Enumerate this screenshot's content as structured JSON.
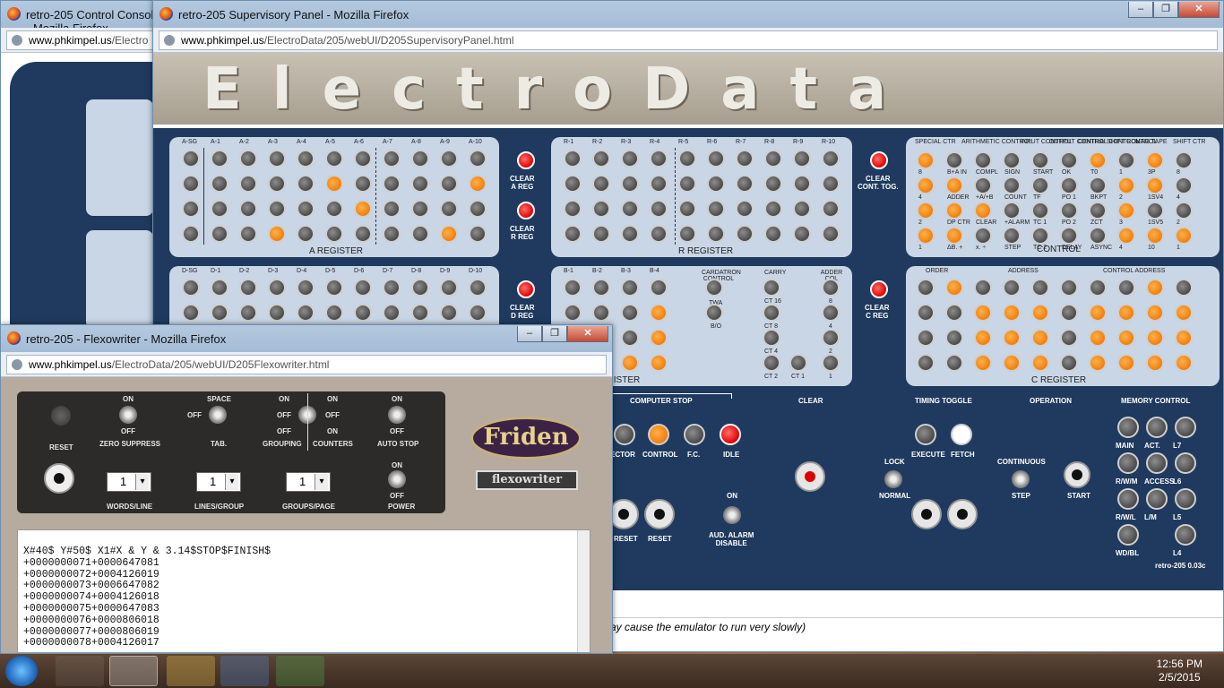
{
  "console_window": {
    "title": "retro-205 Control Console - Mozilla Firefox",
    "url_host": "www.phkimpel.us",
    "url_rest": "/Electro"
  },
  "supervisory": {
    "title": "retro-205 Supervisory Panel - Mozilla Firefox",
    "url_host": "www.phkimpel.us",
    "url_rest": "/ElectroData/205/webUI/D205SupervisoryPanel.html",
    "banner": "ElectroData",
    "a_labels": [
      "A-SG",
      "A-1",
      "A-2",
      "A-3",
      "A-4",
      "A-5",
      "A-6",
      "A-7",
      "A-8",
      "A-9",
      "A-10"
    ],
    "r_labels": [
      "R-1",
      "R-2",
      "R-3",
      "R-4",
      "R-5",
      "R-6",
      "R-7",
      "R-8",
      "R-9",
      "R-10"
    ],
    "d_labels": [
      "D-SG",
      "D-1",
      "D-2",
      "D-3",
      "D-4",
      "D-5",
      "D-6",
      "D-7",
      "D-8",
      "D-9",
      "D-10"
    ],
    "b_labels": [
      "B-1",
      "B-2",
      "B-3",
      "B-4"
    ],
    "a_register": "A REGISTER",
    "r_register": "R REGISTER",
    "c_register": "C REGISTER",
    "control": "CONTROL",
    "b_register_partial": "GISTER",
    "clear_a": "CLEAR\nA REG",
    "clear_r": "CLEAR\nR REG",
    "clear_d": "CLEAR\nD REG",
    "clear_cont": "CLEAR\nCONT. TOG.",
    "clear_c": "CLEAR\nC REG",
    "control_heads": [
      "SPECIAL CTR",
      "ARITHMETIC CONTROL",
      "INPUT CONTROL",
      "OUTPUT CONTROL",
      "CENTRAL CONTROL",
      "SHIFT CONTROL",
      "MAG TAPE",
      "SHIFT CTR"
    ],
    "control_cells": [
      "8",
      "B+A IN",
      "COMPL",
      "SIGN",
      "START",
      "OK",
      "T0",
      "1",
      "3P",
      "8",
      "4",
      "ADDER",
      "+A/+B",
      "COUNT",
      "TF",
      "PO 1",
      "BKPT",
      "2",
      "1SV4",
      "4",
      "2",
      "DP CTR",
      "CLEAR",
      "+ALARM",
      "TC 1",
      "PO 2",
      "ZCT",
      "3",
      "1SV5",
      "2",
      "1",
      "ΔB. +",
      "x. ÷",
      "STEP",
      "TC 2",
      "DELAY",
      "ASYNC",
      "4",
      "10",
      "1"
    ],
    "c_heads": [
      "ORDER",
      "ADDRESS",
      "CONTROL ADDRESS"
    ],
    "cardatron": "CARDATRON CONTROL",
    "twa": "TWA",
    "bo": "B/O",
    "carry": "CARRY",
    "adder_col": "ADDER COL",
    "carry_cells": [
      "CT 16",
      "CT 8",
      "CT 4",
      "CT 2",
      "CT 1"
    ],
    "adder_cells": [
      "8",
      "4",
      "2",
      "1"
    ],
    "computer_stop": "COMPUTER STOP",
    "clear": "CLEAR",
    "timing_toggle": "TIMING TOGGLE",
    "operation": "OPERATION",
    "memory_control": "MEMORY CONTROL",
    "stop_lamps": [
      "ECTOR",
      "CONTROL",
      "F.C.",
      "IDLE"
    ],
    "execute": "EXECUTE",
    "fetch": "FETCH",
    "lock": "LOCK",
    "normal": "NORMAL",
    "continuous": "CONTINUOUS",
    "step": "STEP",
    "start": "START",
    "reset1": "RESET",
    "reset2": "RESET",
    "aud_on": "ON",
    "aud_alarm": "AUD. ALARM\nDISABLE",
    "mem": [
      "MAIN",
      "ACT.",
      "L7",
      "R/W/M",
      "ACCESS",
      "L6",
      "R/W/L",
      "L/M",
      "L5",
      "WD/BL",
      "L4"
    ],
    "version": "retro-205 0.03c",
    "status_text": "ay cause the emulator to run very slowly)"
  },
  "flexowriter": {
    "title": "retro-205 - Flexowriter - Mozilla Firefox",
    "url_host": "www.phkimpel.us",
    "url_rest": "/ElectroData/205/webUI/D205Flexowriter.html",
    "reset": "RESET",
    "zero_on": "ON",
    "zero_off": "OFF",
    "zero": "ZERO SUPPRESS",
    "tab_space": "SPACE",
    "tab_off": "OFF",
    "tab": "TAB.",
    "grp_on": "ON",
    "grp_off": "OFF",
    "grouping": "GROUPING",
    "cnt_on": "ON",
    "cnt_off": "OFF",
    "counters": "COUNTERS",
    "auto_on": "ON",
    "auto_off": "OFF",
    "auto_stop": "AUTO STOP",
    "words_value": "1",
    "words": "WORDS/LINE",
    "lines_value": "1",
    "lines": "LINES/GROUP",
    "groups_value": "1",
    "groups": "GROUPS/PAGE",
    "pwr_on": "ON",
    "pwr_off": "OFF",
    "power": "POWER",
    "brand": "Friden",
    "brand2": "flexowriter",
    "paper_lines": [
      "X#40$ Y#50$ X1#X & Y & 3.14$STOP$FINISH$",
      "+0000000071+0000647081",
      "+0000000072+0004126019",
      "+0000000073+0006647082",
      "+0000000074+0004126018",
      "+0000000075+0000647083",
      "+0000000076+0000806018",
      "+0000000077+0000806019",
      "+0000000078+0004126017"
    ]
  },
  "taskbar": {
    "time": "12:56 PM",
    "date": "2/5/2015"
  },
  "colors": {
    "lamp_on": "#f07f0c",
    "lamp_red": "#e20000",
    "panel_bg": "#1f3a5e"
  }
}
